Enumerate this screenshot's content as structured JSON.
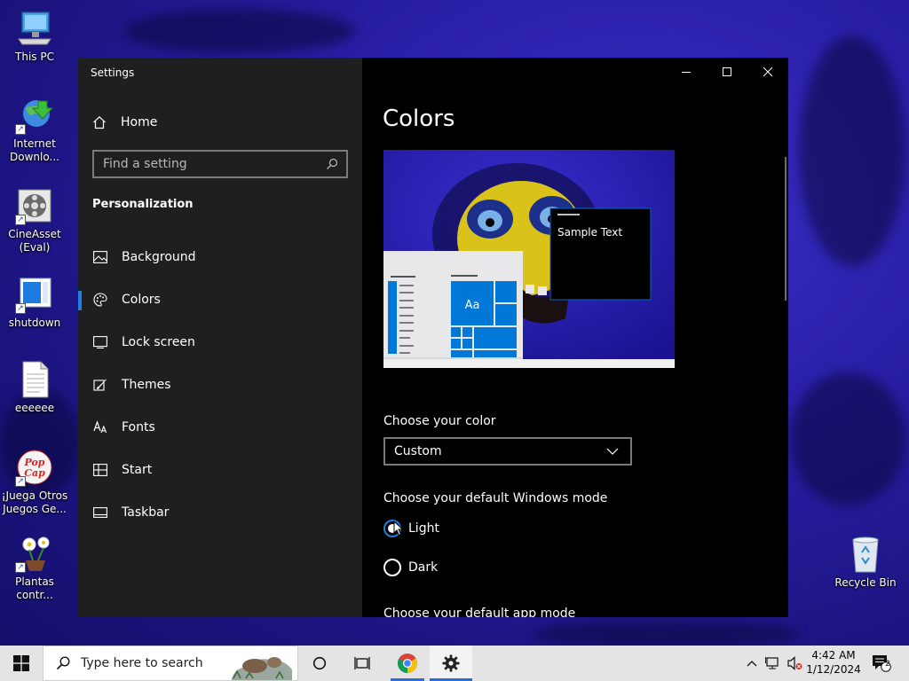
{
  "desktop": {
    "icons": [
      {
        "label": "This PC"
      },
      {
        "label": "Internet Downlo..."
      },
      {
        "label": "CineAsset (Eval)"
      },
      {
        "label": "shutdown"
      },
      {
        "label": "eeeeee"
      },
      {
        "label": "¡Juega Otros Juegos Ge..."
      },
      {
        "label": "Plantas contr..."
      },
      {
        "label": "Recycle Bin"
      }
    ]
  },
  "window": {
    "title": "Settings",
    "controls": {
      "minimize": "—",
      "maximize": "☐",
      "close": "✕"
    }
  },
  "sidebar": {
    "home_label": "Home",
    "search_placeholder": "Find a setting",
    "section_title": "Personalization",
    "items": [
      {
        "label": "Background",
        "icon": "picture-icon"
      },
      {
        "label": "Colors",
        "icon": "palette-icon",
        "selected": true
      },
      {
        "label": "Lock screen",
        "icon": "lock-screen-icon"
      },
      {
        "label": "Themes",
        "icon": "brush-icon"
      },
      {
        "label": "Fonts",
        "icon": "font-icon"
      },
      {
        "label": "Start",
        "icon": "start-icon"
      },
      {
        "label": "Taskbar",
        "icon": "taskbar-icon"
      }
    ]
  },
  "main": {
    "title": "Colors",
    "preview": {
      "sample_text": "Sample Text",
      "tile_text": "Aa",
      "accent_color": "#0078d7"
    },
    "choose_color_label": "Choose your color",
    "choose_color_value": "Custom",
    "windows_mode_label": "Choose your default Windows mode",
    "windows_mode_options": [
      {
        "label": "Light",
        "selected": true
      },
      {
        "label": "Dark",
        "selected": false
      }
    ],
    "app_mode_label": "Choose your default app mode"
  },
  "taskbar": {
    "search_placeholder": "Type here to search",
    "time": "4:42 AM",
    "date": "1/12/2024",
    "notification_count": "2"
  }
}
